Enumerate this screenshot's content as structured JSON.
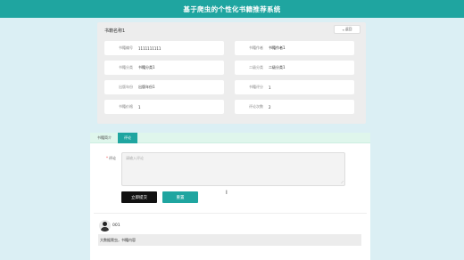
{
  "app": {
    "title": "基于爬虫的个性化书籍推荐系统"
  },
  "detail": {
    "book_name": "书籍名称1",
    "back_label": "返回",
    "fields": [
      {
        "label": "书籍编号",
        "value": "1111111111"
      },
      {
        "label": "书籍作者",
        "value": "书籍作者1"
      },
      {
        "label": "书籍分类",
        "value": "书籍分类1"
      },
      {
        "label": "二级分类",
        "value": "二级分类1"
      },
      {
        "label": "出版年份",
        "value": "出版年份1"
      },
      {
        "label": "书籍评分",
        "value": "1"
      },
      {
        "label": "书籍价格",
        "value": "1"
      },
      {
        "label": "评论次数",
        "value": "2"
      }
    ]
  },
  "tabs": [
    {
      "label": "书籍简介"
    },
    {
      "label": "评论"
    }
  ],
  "comment_form": {
    "required_mark": "*",
    "label": "评论",
    "placeholder": "请输入评论",
    "submit_label": "立即提交",
    "reset_label": "重置"
  },
  "comments": [
    {
      "user": "001",
      "text": "大数据爬虫，书籍内容"
    }
  ],
  "icons": {
    "back": "arrow-left-icon",
    "resize": "resize-handle-icon",
    "cursor": "text-cursor-icon",
    "avatar": "user-avatar"
  },
  "colors": {
    "primary": "#1fa5a0",
    "submit": "#111111",
    "page_bg": "#dbeff4"
  }
}
